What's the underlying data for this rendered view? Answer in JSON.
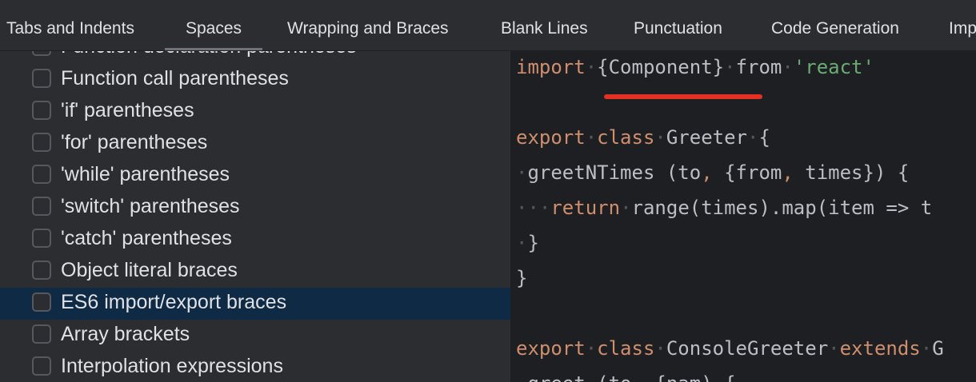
{
  "tabs": [
    "Tabs and Indents",
    "Spaces",
    "Wrapping and Braces",
    "Blank Lines",
    "Punctuation",
    "Code Generation",
    "Imp"
  ],
  "active_tab": "Spaces",
  "options": [
    {
      "label": "Function declaration parentheses",
      "checked": false,
      "selected": false
    },
    {
      "label": "Function call parentheses",
      "checked": false,
      "selected": false
    },
    {
      "label": "'if' parentheses",
      "checked": false,
      "selected": false
    },
    {
      "label": "'for' parentheses",
      "checked": false,
      "selected": false
    },
    {
      "label": "'while' parentheses",
      "checked": false,
      "selected": false
    },
    {
      "label": "'switch' parentheses",
      "checked": false,
      "selected": false
    },
    {
      "label": "'catch' parentheses",
      "checked": false,
      "selected": false
    },
    {
      "label": "Object literal braces",
      "checked": false,
      "selected": false
    },
    {
      "label": "ES6 import/export braces",
      "checked": false,
      "selected": true
    },
    {
      "label": "Array brackets",
      "checked": false,
      "selected": false
    },
    {
      "label": "Interpolation expressions",
      "checked": false,
      "selected": false
    }
  ],
  "code": {
    "l1": {
      "kw": "import",
      "braces": "{Component}",
      "from": "from",
      "str": "'react'"
    },
    "l2": {
      "kw1": "export",
      "kw2": "class",
      "name": "Greeter",
      "brace": "{"
    },
    "l3": {
      "text1": "greetNTimes (to",
      "comma": ",",
      "text2": " {from",
      "comma2": ",",
      "text3": " times}) {"
    },
    "l4": {
      "kw": "return",
      "text": "range(times).map(item => t"
    },
    "l5": {
      "text": "}"
    },
    "l6": {
      "text": "}"
    },
    "l7": {
      "kw1": "export",
      "kw2": "class",
      "name": "ConsoleGreeter",
      "kw3": "extends",
      "tail": "G"
    },
    "l8": {
      "text": "greet (to, {nam) {"
    }
  }
}
